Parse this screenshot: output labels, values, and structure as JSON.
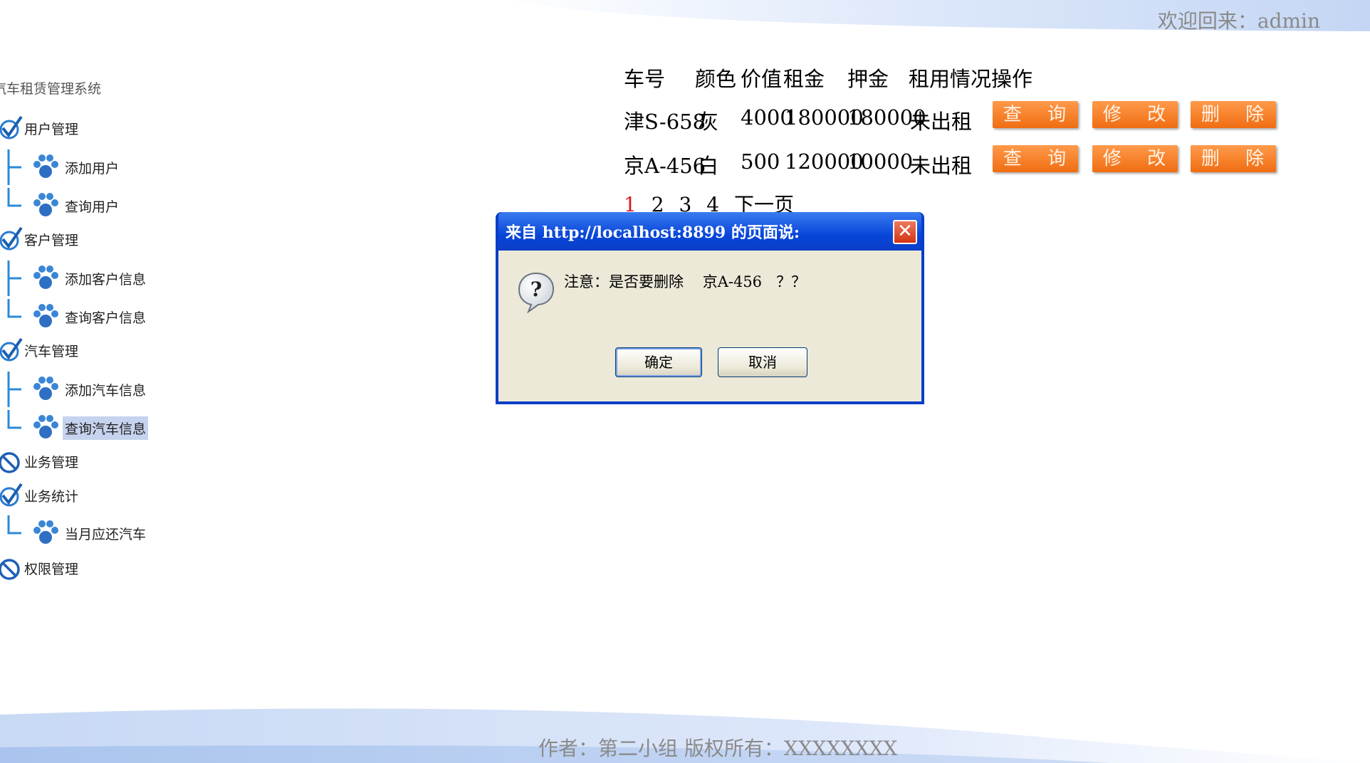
{
  "header": {
    "welcome": "欢迎回来：admin"
  },
  "sidebar": {
    "title": "汽车租赁管理系统",
    "groups": [
      {
        "label": "用户管理",
        "icon": "check-icon",
        "children": [
          {
            "label": "添加用户",
            "icon": "paw-icon"
          },
          {
            "label": "查询用户",
            "icon": "paw-icon"
          }
        ]
      },
      {
        "label": "客户管理",
        "icon": "check-icon",
        "children": [
          {
            "label": "添加客户信息",
            "icon": "paw-icon"
          },
          {
            "label": "查询客户信息",
            "icon": "paw-icon"
          }
        ]
      },
      {
        "label": "汽车管理",
        "icon": "check-icon",
        "children": [
          {
            "label": "添加汽车信息",
            "icon": "paw-icon"
          },
          {
            "label": "查询汽车信息",
            "icon": "paw-icon",
            "selected": true
          }
        ]
      },
      {
        "label": "业务管理",
        "icon": "no-icon",
        "children": []
      },
      {
        "label": "业务统计",
        "icon": "check-icon",
        "children": [
          {
            "label": "当月应还汽车",
            "icon": "paw-icon"
          }
        ]
      },
      {
        "label": "权限管理",
        "icon": "no-icon",
        "children": []
      }
    ]
  },
  "table": {
    "headers": [
      "车号",
      "颜色",
      "价值",
      "租金",
      "押金",
      "租用情况",
      "操作"
    ],
    "rows": [
      {
        "plate": "津S-658",
        "color": "灰",
        "value": "4000",
        "rent": "180000",
        "deposit": "180000",
        "status": "未出租"
      },
      {
        "plate": "京A-456",
        "color": "白",
        "value": "500",
        "rent": "120000",
        "deposit": "10000",
        "status": "未出租"
      }
    ],
    "actions": {
      "query": "查 询",
      "edit": "修 改",
      "delete": "删 除"
    },
    "action_color": "#f47b20"
  },
  "pager": {
    "pages": [
      "1",
      "2",
      "3",
      "4"
    ],
    "current": "1",
    "next": "下一页"
  },
  "dialog": {
    "title": "来自 http://localhost:8899 的页面说:",
    "message": "注意：是否要删除    京A-456   ？？",
    "ok": "确定",
    "cancel": "取消",
    "icon": "question-icon"
  },
  "footer": {
    "text": "作者：第二小组  版权所有：XXXXXXXX"
  }
}
